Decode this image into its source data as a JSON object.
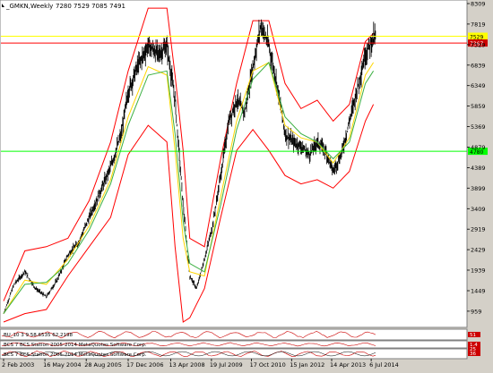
{
  "window": {
    "title": "_GMKN,Weekly",
    "ohlc": "7280 7529 7085 7491"
  },
  "colors": {
    "background": "#ffffff",
    "frame": "#d4d0c8",
    "candle": "#000000",
    "band": "#ff0000",
    "ma_fast": "#ffd700",
    "ma_slow": "#3cb043",
    "hline_yellow": "#ffff00",
    "hline_red": "#ff0000",
    "hline_green": "#00ff00"
  },
  "chart_data": {
    "type": "line",
    "x_tick_labels": [
      "2 Feb 2003",
      "16 May 2004",
      "28 Aug 2005",
      "17 Dec 2006",
      "13 Apr 2008",
      "19 Jul 2009",
      "17 Oct 2010",
      "15 Jan 2012",
      "14 Apr 2013",
      "6 Jul 2014"
    ],
    "y_tick_labels": [
      "8309",
      "7819",
      "7329",
      "6839",
      "6349",
      "5859",
      "5369",
      "4879",
      "4389",
      "3899",
      "3409",
      "2919",
      "2429",
      "1939",
      "1449",
      "959"
    ],
    "ylim": [
      700,
      8309
    ],
    "series": [
      {
        "role": "price",
        "x": [
          "2003-02-02",
          "2003-06-01",
          "2003-10-01",
          "2004-02-01",
          "2004-06-01",
          "2004-10-01",
          "2005-02-01",
          "2005-06-01",
          "2005-10-01",
          "2006-02-01",
          "2006-06-01",
          "2006-10-01",
          "2006-12-17",
          "2007-04-01",
          "2007-08-01",
          "2007-12-01",
          "2008-03-01",
          "2008-06-01",
          "2008-09-01",
          "2008-11-15",
          "2009-02-01",
          "2009-05-01",
          "2009-08-01",
          "2009-11-01",
          "2010-02-01",
          "2010-05-01",
          "2010-08-01",
          "2010-11-01",
          "2011-02-01",
          "2011-05-01",
          "2011-08-01",
          "2011-11-01",
          "2012-02-01",
          "2012-05-01",
          "2012-08-01",
          "2012-11-01",
          "2013-02-01",
          "2013-05-01",
          "2013-08-01",
          "2013-11-01",
          "2014-02-01",
          "2014-05-01",
          "2014-08-01"
        ],
        "values": [
          900,
          1600,
          1900,
          1500,
          1300,
          1700,
          2300,
          2600,
          3200,
          3800,
          4400,
          5200,
          6200,
          6800,
          7300,
          7100,
          7300,
          6000,
          3500,
          1800,
          1500,
          2200,
          3000,
          4200,
          5500,
          6000,
          5700,
          6800,
          7800,
          7300,
          6400,
          5200,
          5000,
          4900,
          4700,
          5000,
          4800,
          4300,
          4700,
          5500,
          6300,
          7100,
          7491
        ]
      },
      {
        "role": "band-upper",
        "x": [
          "2003-02-02",
          "2003-10-01",
          "2004-06-01",
          "2005-02-01",
          "2005-10-01",
          "2006-06-01",
          "2006-12-17",
          "2007-08-01",
          "2008-03-01",
          "2008-06-01",
          "2008-09-01",
          "2008-11-15",
          "2009-05-01",
          "2009-11-01",
          "2010-05-01",
          "2010-11-01",
          "2011-05-01",
          "2011-11-01",
          "2012-05-01",
          "2012-11-01",
          "2013-05-01",
          "2013-11-01",
          "2014-05-01",
          "2014-08-01"
        ],
        "values": [
          1200,
          2400,
          2500,
          2700,
          3600,
          5000,
          6700,
          8200,
          8200,
          6600,
          4800,
          2700,
          2500,
          4600,
          6400,
          7900,
          7900,
          6400,
          5800,
          6000,
          5500,
          5900,
          7400,
          7600
        ]
      },
      {
        "role": "band-lower",
        "x": [
          "2003-02-02",
          "2003-10-01",
          "2004-06-01",
          "2005-02-01",
          "2005-10-01",
          "2006-06-01",
          "2006-12-17",
          "2007-08-01",
          "2008-03-01",
          "2008-06-01",
          "2008-09-01",
          "2008-11-15",
          "2009-05-01",
          "2009-11-01",
          "2010-05-01",
          "2010-11-01",
          "2011-05-01",
          "2011-11-01",
          "2012-05-01",
          "2012-11-01",
          "2013-05-01",
          "2013-11-01",
          "2014-05-01",
          "2014-08-01"
        ],
        "values": [
          700,
          900,
          1000,
          1800,
          2500,
          3200,
          4700,
          5400,
          5000,
          2500,
          700,
          800,
          1500,
          3200,
          4800,
          5300,
          4800,
          4200,
          4000,
          4100,
          3900,
          4300,
          5500,
          5900
        ]
      },
      {
        "role": "ma-fast",
        "x": [
          "2003-02-02",
          "2003-10-01",
          "2004-06-01",
          "2005-02-01",
          "2005-10-01",
          "2006-06-01",
          "2006-12-17",
          "2007-08-01",
          "2008-03-01",
          "2008-06-01",
          "2008-09-01",
          "2008-11-15",
          "2009-05-01",
          "2009-11-01",
          "2010-05-01",
          "2010-11-01",
          "2011-05-01",
          "2011-11-01",
          "2012-05-01",
          "2012-11-01",
          "2013-05-01",
          "2013-11-01",
          "2014-05-01",
          "2014-08-01"
        ],
        "values": [
          900,
          1700,
          1600,
          2200,
          3000,
          4100,
          5600,
          6800,
          6600,
          4800,
          2700,
          1900,
          1800,
          3700,
          5500,
          6700,
          6900,
          5400,
          5100,
          5000,
          4500,
          5100,
          6600,
          6900
        ]
      },
      {
        "role": "ma-slow",
        "x": [
          "2003-02-02",
          "2003-10-01",
          "2004-06-01",
          "2005-02-01",
          "2005-10-01",
          "2006-06-01",
          "2006-12-17",
          "2007-08-01",
          "2008-03-01",
          "2008-06-01",
          "2008-09-01",
          "2008-11-15",
          "2009-05-01",
          "2009-11-01",
          "2010-05-01",
          "2010-11-01",
          "2011-05-01",
          "2011-11-01",
          "2012-05-01",
          "2012-11-01",
          "2013-05-01",
          "2013-11-01",
          "2014-05-01",
          "2014-08-01"
        ],
        "values": [
          900,
          1600,
          1650,
          2100,
          2900,
          4000,
          5400,
          6600,
          6700,
          5200,
          3100,
          2100,
          1900,
          3500,
          5300,
          6500,
          6900,
          5600,
          5200,
          5000,
          4600,
          5000,
          6400,
          6700
        ]
      }
    ],
    "horizontal_lines": [
      {
        "value": 7529,
        "label": "7529",
        "color": "yellow"
      },
      {
        "value": 7367,
        "label": "7367",
        "color": "red"
      },
      {
        "value": 4780,
        "label": "4780",
        "color": "green"
      }
    ],
    "subpanels": [
      {
        "label": "BU_10 3 9   58.6535 62.2198",
        "right_label": "51"
      },
      {
        "label": "BCS 7   BCS Station   2005-2014   MetaQuotes Software Corp.",
        "right_label": "1.4"
      },
      {
        "label": "BCS 7   BCS Station   2005-2014   MetaQuotes Software Corp.",
        "right_label": "25"
      },
      {
        "label": "",
        "right_label": "36"
      }
    ]
  }
}
